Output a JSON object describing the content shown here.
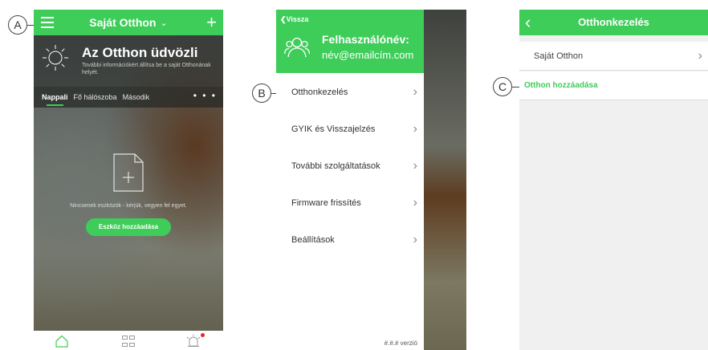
{
  "callouts": {
    "a": "A",
    "b": "B",
    "c": "C"
  },
  "phone1": {
    "header": {
      "title": "Saját Otthon",
      "dropdown_icon": "chevron-down-icon",
      "add_icon": "plus-icon",
      "menu_icon": "hamburger-icon"
    },
    "welcome": {
      "title": "Az Otthon üdvözli",
      "subtitle": "További információkért állítsa be a saját Otthonának helyét.",
      "weather_icon": "sun-icon"
    },
    "tabs": [
      "Nappali",
      "Fő hálószoba",
      "Második"
    ],
    "active_tab": "Nappali",
    "more_label": "• • •",
    "empty_text": "Nincsenek eszközök - kérjük, vegyen fel egyet.",
    "add_device_button": "Eszköz hozzáadása",
    "bottom_nav": [
      "home-icon",
      "grid-icon",
      "alarm-icon"
    ]
  },
  "phone2": {
    "back_label": "Vissza",
    "username_label": "Felhasználónév:",
    "email": "név@emailcím.com",
    "menu": [
      {
        "label": "Otthonkezelés"
      },
      {
        "label": "GYIK és Visszajelzés"
      },
      {
        "label": "További szolgáltatások"
      },
      {
        "label": "Firmware frissítés"
      },
      {
        "label": "Beállítások"
      }
    ],
    "version": "#.#.# verzió"
  },
  "phone3": {
    "title": "Otthonkezelés",
    "home_item": "Saját Otthon",
    "add_home": "Otthon hozzáadása"
  },
  "colors": {
    "brand_green": "#3dcd58",
    "notification_red": "#e22222"
  }
}
